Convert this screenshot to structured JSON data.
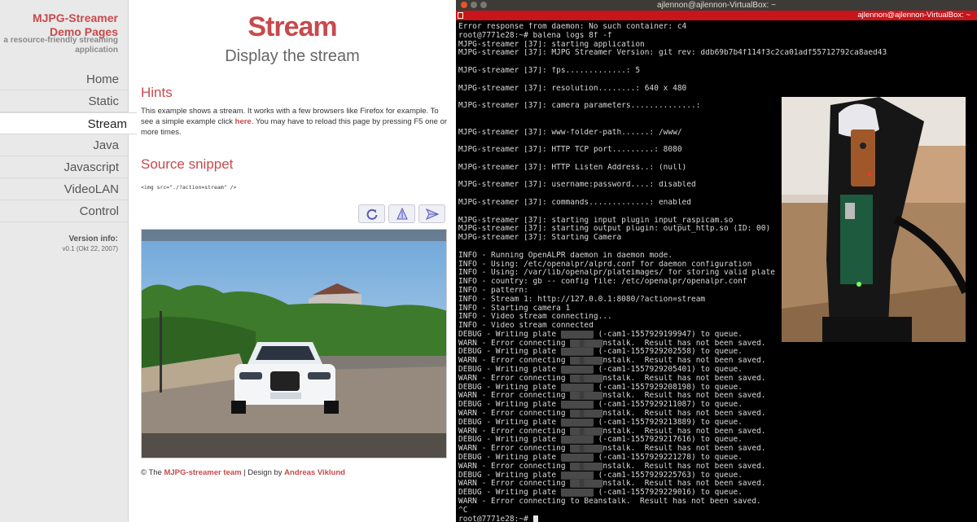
{
  "sidebar": {
    "brand_line1": "MJPG-Streamer",
    "brand_line2": "Demo Pages",
    "tagline": "a resource-friendly streaming application",
    "nav": [
      {
        "label": "Home",
        "active": false
      },
      {
        "label": "Static",
        "active": false
      },
      {
        "label": "Stream",
        "active": true
      },
      {
        "label": "Java",
        "active": false
      },
      {
        "label": "Javascript",
        "active": false
      },
      {
        "label": "VideoLAN",
        "active": false
      },
      {
        "label": "Control",
        "active": false
      }
    ],
    "version_label": "Version info:",
    "version_text": "v0.1 (Okt 22, 2007)"
  },
  "page": {
    "title": "Stream",
    "subtitle": "Display the stream",
    "hints_heading": "Hints",
    "hint_part1": "This example shows a stream. It works with a few browsers like Firefox for example. To see a simple example click ",
    "hint_link": "here",
    "hint_part2": ". You may have to reload this page by pressing F5 one or more times.",
    "snippet_heading": "Source snippet",
    "snippet_code": "<img src=\"./?action=stream\" />",
    "buttons": [
      {
        "icon": "rotate-icon"
      },
      {
        "icon": "flip-vertical-icon"
      },
      {
        "icon": "flip-horizontal-icon"
      }
    ],
    "footer_prefix": "© The ",
    "footer_team": "MJPG-streamer team",
    "footer_mid": " | Design by ",
    "footer_designer": "Andreas Viklund"
  },
  "terminal": {
    "window_title": "ajlennon@ajlennon-VirtualBox: ~",
    "tab_title": "ajlennon@ajlennon-VirtualBox: ~",
    "lines": [
      "Error response from daemon: No such container: c4",
      "root@7771e28:~# balena logs 8f -f",
      "MJPG-streamer [37]: starting application",
      "MJPG-streamer [37]: MJPG Streamer Version: git rev: ddb69b7b4f114f3c2ca01adf55712792ca8aed43",
      "",
      "MJPG-streamer [37]: fps.............: 5",
      "",
      "MJPG-streamer [37]: resolution........: 640 x 480",
      "",
      "MJPG-streamer [37]: camera parameters..............:",
      "",
      "",
      "MJPG-streamer [37]: www-folder-path......: /www/",
      "",
      "MJPG-streamer [37]: HTTP TCP port.........: 8080",
      "",
      "MJPG-streamer [37]: HTTP Listen Address..: (null)",
      "",
      "MJPG-streamer [37]: username:password....: disabled",
      "",
      "MJPG-streamer [37]: commands.............: enabled",
      "",
      "MJPG-streamer [37]: starting input plugin input_raspicam.so",
      "MJPG-streamer [37]: starting output plugin: output_http.so (ID: 00)",
      "MJPG-streamer [37]: Starting Camera",
      "",
      "INFO - Running OpenALPR daemon in daemon mode.",
      "INFO - Using: /etc/openalpr/alprd.conf for daemon configuration",
      "INFO - Using: /var/lib/openalpr/plateimages/ for storing valid plate",
      "INFO - country: gb -- config file: /etc/openalpr/openalpr.conf",
      "INFO - pattern:",
      "INFO - Stream 1: http://127.0.0.1:8080/?action=stream",
      "INFO - Starting camera 1",
      "INFO - Video stream connecting...",
      "INFO - Video stream connected",
      "DEBUG - Writing plate ▒▒▒▒▒▒▒ (-cam1-1557929199947) to queue.",
      "WARN - Error connecting ▒▒ ▒▒▒▒nstalk.  Result has not been saved.",
      "DEBUG - Writing plate ▒▒▒▒▒▒▒ (-cam1-1557929202558) to queue.",
      "WARN - Error connecting ▒▒ ▒▒▒▒nstalk.  Result has not been saved.",
      "DEBUG - Writing plate ▒▒▒▒▒▒▒ (-cam1-1557929205401) to queue.",
      "WARN - Error connecting ▒▒ ▒▒▒▒nstalk.  Result has not been saved.",
      "DEBUG - Writing plate ▒▒▒▒▒▒▒ (-cam1-1557929208198) to queue.",
      "WARN - Error connecting ▒▒ ▒▒▒▒nstalk.  Result has not been saved.",
      "DEBUG - Writing plate ▒▒▒▒▒▒▒ (-cam1-1557929211087) to queue.",
      "WARN - Error connecting ▒▒ ▒▒▒▒nstalk.  Result has not been saved.",
      "DEBUG - Writing plate ▒▒▒▒▒▒▒ (-cam1-1557929213889) to queue.",
      "WARN - Error connecting ▒▒ ▒▒▒▒nstalk.  Result has not been saved.",
      "DEBUG - Writing plate ▒▒▒▒▒▒▒ (-cam1-1557929217616) to queue.",
      "WARN - Error connecting ▒▒ ▒▒▒▒nstalk.  Result has not been saved.",
      "DEBUG - Writing plate ▒▒▒▒▒▒▒ (-cam1-1557929221278) to queue.",
      "WARN - Error connecting ▒▒ ▒▒▒▒nstalk.  Result has not been saved.",
      "DEBUG - Writing plate ▒▒▒▒▒▒▒ (-cam1-1557929225763) to queue.",
      "WARN - Error connecting ▒▒ ▒▒▒▒nstalk.  Result has not been saved.",
      "DEBUG - Writing plate ▒▒▒▒▒▒▒ (-cam1-1557929229016) to queue.",
      "WARN - Error connecting to Beanstalk.  Result has not been saved.",
      "^C",
      "root@7771e28:~# "
    ]
  },
  "colors": {
    "accent": "#c8494c",
    "terminal_bg": "#000000",
    "terminal_tab": "#c8141b"
  }
}
